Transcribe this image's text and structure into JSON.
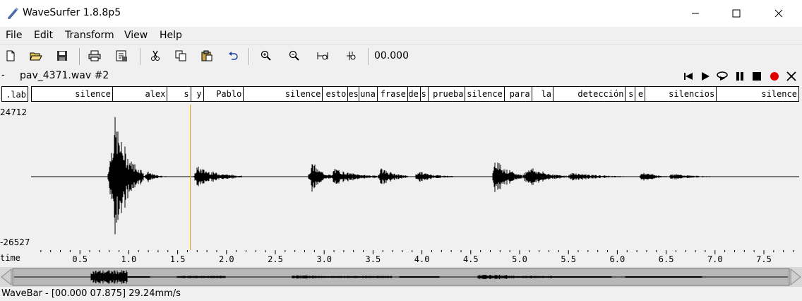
{
  "window": {
    "title": "WaveSurfer 1.8.8p5"
  },
  "menu": {
    "file": "File",
    "edit": "Edit",
    "transform": "Transform",
    "view": "View",
    "help": "Help"
  },
  "toolbar": {
    "time": "00.000",
    "icons": [
      "new-file-icon",
      "open-folder-icon",
      "save-icon",
      "print-icon",
      "properties-icon",
      "cut-icon",
      "copy-icon",
      "paste-icon",
      "undo-icon",
      "zoom-in-icon",
      "zoom-out-icon",
      "zoom-fit-icon",
      "zoom-selection-icon"
    ]
  },
  "pane": {
    "dash": "-",
    "title": "pav_4371.wav #2",
    "controls": [
      "skip-back-icon",
      "play-icon",
      "loop-play-icon",
      "pause-icon",
      "stop-icon",
      "record-icon",
      "close-pane-icon"
    ]
  },
  "labels": {
    "tag": ".lab",
    "segments": [
      {
        "text": "silence",
        "end": 0.83
      },
      {
        "text": "alex",
        "end": 1.39
      },
      {
        "text": "s",
        "end": 1.63
      },
      {
        "text": "y",
        "end": 1.76
      },
      {
        "text": "Pablo",
        "end": 2.17
      },
      {
        "text": "silence",
        "end": 2.98
      },
      {
        "text": "esto",
        "end": 3.24
      },
      {
        "text": "es",
        "end": 3.35
      },
      {
        "text": "una",
        "end": 3.54
      },
      {
        "text": "frase",
        "end": 3.85
      },
      {
        "text": "de",
        "end": 3.98
      },
      {
        "text": "s",
        "end": 4.06
      },
      {
        "text": "prueba",
        "end": 4.44
      },
      {
        "text": "silence",
        "end": 4.84
      },
      {
        "text": "para",
        "end": 5.12
      },
      {
        "text": "la",
        "end": 5.34
      },
      {
        "text": "detección",
        "end": 6.08
      },
      {
        "text": "s",
        "end": 6.18
      },
      {
        "text": "e",
        "end": 6.28
      },
      {
        "text": "silencios",
        "end": 7.01
      },
      {
        "text": "silence",
        "end": 7.875
      }
    ]
  },
  "waveform": {
    "ymax": "24712",
    "ymin": "-26527",
    "cursor_time": 1.63,
    "bursts": [
      {
        "start": 0.78,
        "peak": 0.86,
        "end": 1.15,
        "amp": 0.98
      },
      {
        "start": 1.15,
        "peak": 1.2,
        "end": 1.38,
        "amp": 0.08
      },
      {
        "start": 1.66,
        "peak": 1.7,
        "end": 2.15,
        "amp": 0.17
      },
      {
        "start": 2.83,
        "peak": 2.88,
        "end": 3.08,
        "amp": 0.24
      },
      {
        "start": 3.08,
        "peak": 3.1,
        "end": 3.55,
        "amp": 0.14
      },
      {
        "start": 3.55,
        "peak": 3.58,
        "end": 3.85,
        "amp": 0.16
      },
      {
        "start": 3.92,
        "peak": 3.96,
        "end": 4.33,
        "amp": 0.09
      },
      {
        "start": 4.72,
        "peak": 4.76,
        "end": 5.02,
        "amp": 0.32
      },
      {
        "start": 5.02,
        "peak": 5.1,
        "end": 5.48,
        "amp": 0.17
      },
      {
        "start": 5.48,
        "peak": 5.55,
        "end": 6.08,
        "amp": 0.07
      },
      {
        "start": 6.22,
        "peak": 6.27,
        "end": 6.52,
        "amp": 0.09
      },
      {
        "start": 6.52,
        "peak": 6.56,
        "end": 7.0,
        "amp": 0.05
      }
    ]
  },
  "time_axis": {
    "label": "time",
    "ticks": [
      "0.5",
      "1.0",
      "1.5",
      "2.0",
      "2.5",
      "3.0",
      "3.5",
      "4.0",
      "4.5",
      "5.0",
      "5.5",
      "6.0",
      "6.5",
      "7.0",
      "7.5"
    ],
    "duration": 7.875
  },
  "status": {
    "text": "WaveBar - [00.000 07.875] 29.24mm/s"
  }
}
